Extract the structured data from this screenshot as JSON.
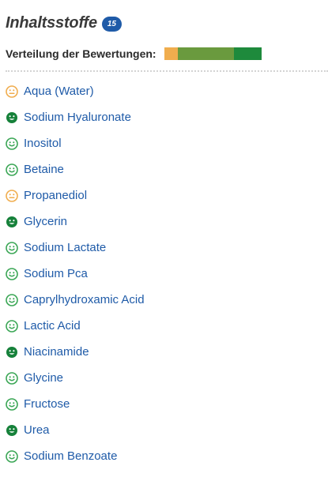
{
  "header": {
    "title": "Inhaltsstoffe",
    "count": "15"
  },
  "distribution": {
    "label": "Verteilung der Bewertungen:",
    "segments": [
      {
        "rating": "neutral",
        "color": "#f0ad4e",
        "fraction": 0.14
      },
      {
        "rating": "good",
        "color": "#6a9a3e",
        "fraction": 0.58
      },
      {
        "rating": "very-good",
        "color": "#1e8a3c",
        "fraction": 0.28
      }
    ]
  },
  "rating_colors": {
    "neutral": "#f0ad4e",
    "good": "#3aa655",
    "very-good": "#16813a"
  },
  "ingredients": [
    {
      "name": "Aqua (Water)",
      "rating": "neutral",
      "icon": "neutral-face-icon"
    },
    {
      "name": "Sodium Hyaluronate",
      "rating": "very-good",
      "icon": "smiley-face-icon"
    },
    {
      "name": "Inositol",
      "rating": "good",
      "icon": "smiley-face-icon"
    },
    {
      "name": "Betaine",
      "rating": "good",
      "icon": "smiley-face-icon"
    },
    {
      "name": "Propanediol",
      "rating": "neutral",
      "icon": "neutral-face-icon"
    },
    {
      "name": "Glycerin",
      "rating": "very-good",
      "icon": "smiley-face-icon"
    },
    {
      "name": "Sodium Lactate",
      "rating": "good",
      "icon": "smiley-face-icon"
    },
    {
      "name": "Sodium Pca",
      "rating": "good",
      "icon": "smiley-face-icon"
    },
    {
      "name": "Caprylhydroxamic Acid",
      "rating": "good",
      "icon": "smiley-face-icon"
    },
    {
      "name": "Lactic Acid",
      "rating": "good",
      "icon": "smiley-face-icon"
    },
    {
      "name": "Niacinamide",
      "rating": "very-good",
      "icon": "smiley-face-icon"
    },
    {
      "name": "Glycine",
      "rating": "good",
      "icon": "smiley-face-icon"
    },
    {
      "name": "Fructose",
      "rating": "good",
      "icon": "smiley-face-icon"
    },
    {
      "name": "Urea",
      "rating": "very-good",
      "icon": "smiley-face-icon"
    },
    {
      "name": "Sodium Benzoate",
      "rating": "good",
      "icon": "smiley-face-icon"
    }
  ]
}
